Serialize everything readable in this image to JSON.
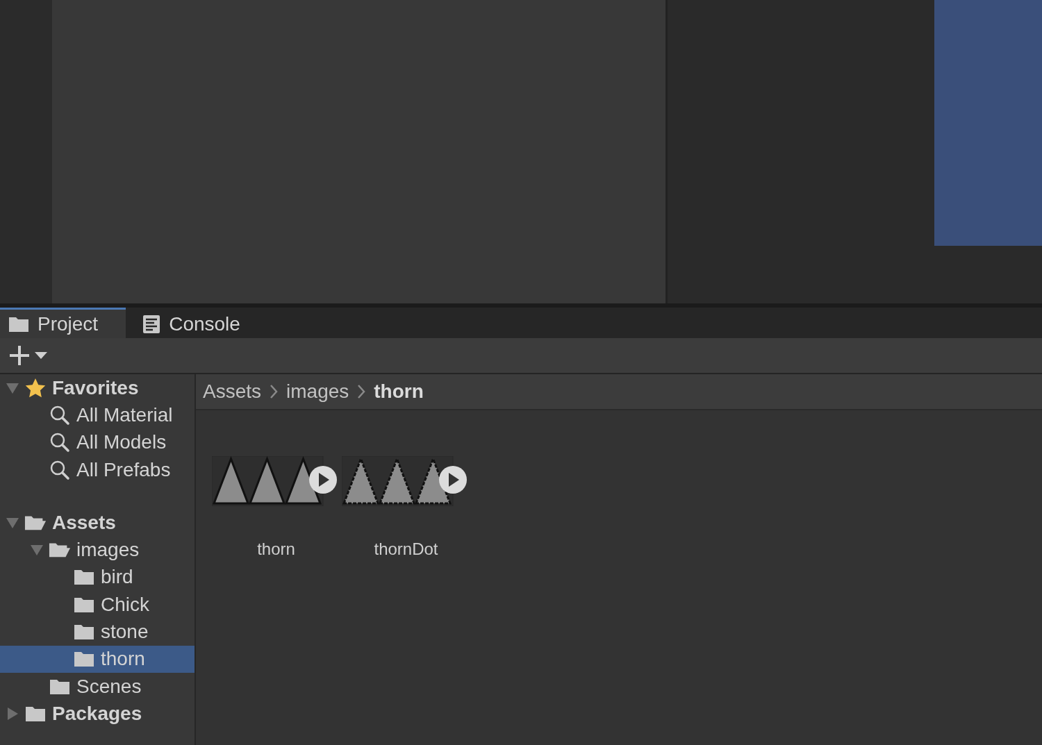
{
  "tabs": [
    {
      "label": "Project",
      "kind": "folder",
      "selected": true
    },
    {
      "label": "Console",
      "kind": "console",
      "selected": false
    }
  ],
  "tree": [
    {
      "label": "Favorites",
      "kind": "favorites",
      "expanded": true,
      "selected": false,
      "children": [
        {
          "label": "All Material",
          "kind": "search",
          "selected": false
        },
        {
          "label": "All Models",
          "kind": "search",
          "selected": false
        },
        {
          "label": "All Prefabs",
          "kind": "search",
          "selected": false
        }
      ]
    },
    {
      "label": "Assets",
      "kind": "folder",
      "expanded": true,
      "selected": false,
      "children": [
        {
          "label": "images",
          "kind": "folder",
          "expanded": true,
          "selected": false,
          "children": [
            {
              "label": "bird",
              "kind": "folder",
              "selected": false
            },
            {
              "label": "Chick",
              "kind": "folder",
              "selected": false
            },
            {
              "label": "stone",
              "kind": "folder",
              "selected": false
            },
            {
              "label": "thorn",
              "kind": "folder",
              "selected": true
            }
          ]
        },
        {
          "label": "Scenes",
          "kind": "folder",
          "selected": false
        }
      ]
    },
    {
      "label": "Packages",
      "kind": "folder",
      "expanded": false,
      "selected": false
    }
  ],
  "breadcrumb": [
    "Assets",
    "images",
    "thorn"
  ],
  "assets": [
    {
      "name": "thorn",
      "kind": "smooth"
    },
    {
      "name": "thornDot",
      "kind": "pixel"
    }
  ]
}
